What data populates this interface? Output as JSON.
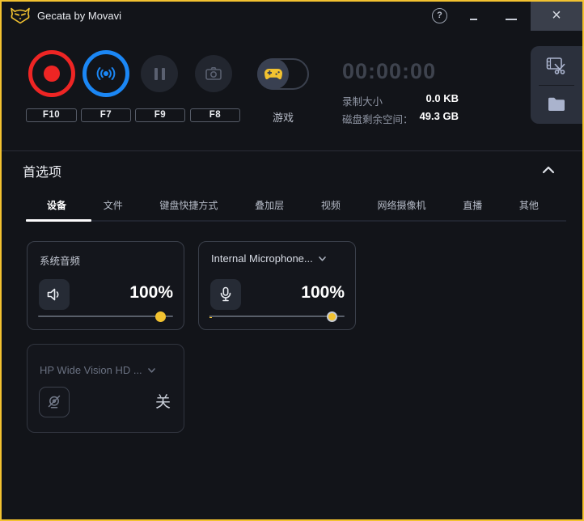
{
  "window": {
    "title": "Gecata by Movavi"
  },
  "titlebar": {
    "help_glyph": "?",
    "close_glyph": "×"
  },
  "recorder": {
    "hotkeys": {
      "record": "F10",
      "stream": "F7",
      "pause": "F9",
      "snapshot": "F8"
    },
    "game_toggle_label": "游戏",
    "timer": "00:00:00",
    "stats": [
      {
        "label": "录制大小",
        "value": "0.0 KB"
      },
      {
        "label": "磁盘剩余空间：",
        "value": "49.3 GB"
      }
    ]
  },
  "preferences": {
    "title": "首选项",
    "tabs": [
      "设备",
      "文件",
      "键盘快捷方式",
      "叠加层",
      "视频",
      "网络摄像机",
      "直播",
      "其他"
    ],
    "active_tab": "设备",
    "system_audio": {
      "label": "系统音频",
      "volume": "100%"
    },
    "microphone": {
      "device": "Internal Microphone...",
      "volume": "100%"
    },
    "webcam": {
      "device": "HP Wide Vision HD ...",
      "state": "关"
    }
  },
  "icons": {
    "owl-logo": "movavi-owl",
    "help-icon": "circled question mark",
    "minimize-icon": "dash",
    "compact-mode-icon": "small dash",
    "close-icon": "×",
    "record-icon": "red dot",
    "stream-icon": "broadcast ((•))",
    "pause-icon": "two bars",
    "snapshot-icon": "camera",
    "gamepad-icon": "game controller",
    "video-editor-icon": "film strip with scissors",
    "folder-icon": "folder",
    "speaker-icon": "speaker with wave",
    "microphone-icon": "microphone",
    "webcam-off-icon": "crossed-out webcam",
    "chevron-up-icon": "^",
    "chevron-down-icon": "v"
  },
  "colors": {
    "accent_yellow": "#f2c230",
    "record_red": "#ee2524",
    "stream_blue": "#1b87f5",
    "background": "#121419",
    "panel": "#2b303c"
  }
}
